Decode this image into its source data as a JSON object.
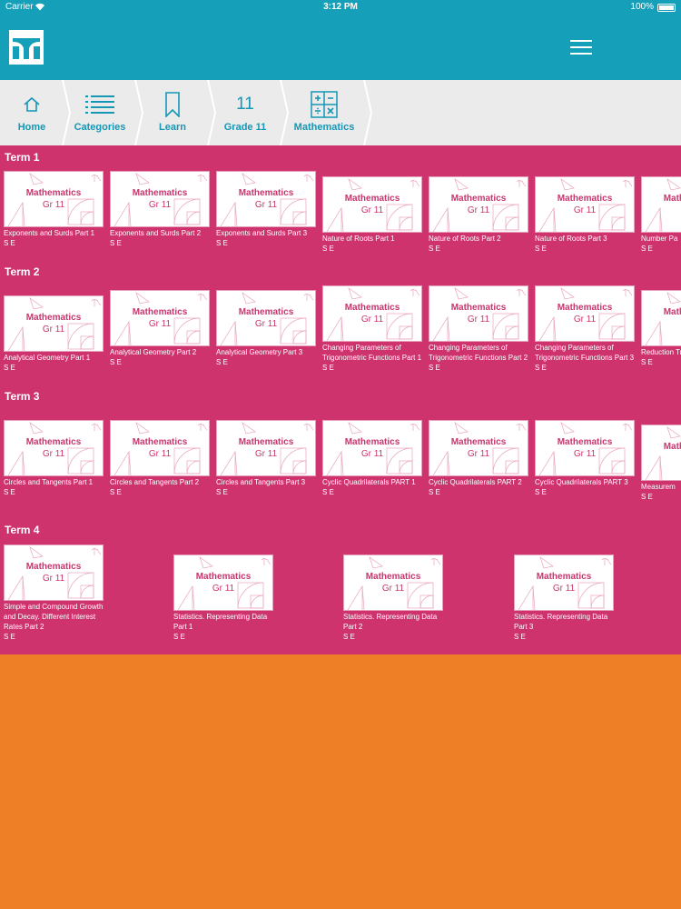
{
  "status_bar": {
    "carrier": "Carrier",
    "time": "3:12 PM",
    "battery": "100%"
  },
  "breadcrumbs": [
    {
      "label": "Home",
      "icon": "home-icon"
    },
    {
      "label": "Categories",
      "icon": "list-icon"
    },
    {
      "label": "Learn",
      "icon": "bookmark-icon"
    },
    {
      "label": "Grade 11",
      "icon_text": "11"
    },
    {
      "label": "Mathematics",
      "icon": "calculator-icon"
    }
  ],
  "colors": {
    "header": "#159fb8",
    "content": "#ce336d",
    "footer": "#ee7f27"
  },
  "terms": [
    {
      "title": "Term 1",
      "tiles": [
        {
          "subject": "Mathematics",
          "grade": "Gr 11",
          "title": "Exponents and Surds Part 1",
          "meta": "S E"
        },
        {
          "subject": "Mathematics",
          "grade": "Gr 11",
          "title": "Exponents and Surds Part 2",
          "meta": "S E"
        },
        {
          "subject": "Mathematics",
          "grade": "Gr 11",
          "title": "Exponents and Surds Part 3",
          "meta": "S E"
        },
        {
          "subject": "Mathematics",
          "grade": "Gr 11",
          "title": "Nature of Roots Part 1",
          "meta": "S E"
        },
        {
          "subject": "Mathematics",
          "grade": "Gr 11",
          "title": "Nature of Roots Part 2",
          "meta": "S E"
        },
        {
          "subject": "Mathematics",
          "grade": "Gr 11",
          "title": "Nature of Roots Part 3",
          "meta": "S E"
        },
        {
          "subject": "Mathematics",
          "grade": "",
          "title": "Number Pa",
          "meta": "S E"
        }
      ]
    },
    {
      "title": "Term 2",
      "tiles": [
        {
          "subject": "Mathematics",
          "grade": "Gr 11",
          "title": "Analytical Geometry Part 1",
          "meta": "S E"
        },
        {
          "subject": "Mathematics",
          "grade": "Gr 11",
          "title": "Analytical Geometry Part 2",
          "meta": "S E"
        },
        {
          "subject": "Mathematics",
          "grade": "Gr 11",
          "title": "Analytical Geometry Part 3",
          "meta": "S E"
        },
        {
          "subject": "Mathematics",
          "grade": "Gr 11",
          "title": "Changing Parameters of Trigonometric Functions Part 1",
          "meta": "S E"
        },
        {
          "subject": "Mathematics",
          "grade": "Gr 11",
          "title": "Changing Parameters of Trigonometric Functions Part 2",
          "meta": "S E"
        },
        {
          "subject": "Mathematics",
          "grade": "Gr 11",
          "title": "Changing Parameters of Trigonometric Functions Part 3",
          "meta": "S E"
        },
        {
          "subject": "Mathematics",
          "grade": "",
          "title": "Reduction Trig Ratios",
          "meta": "S E"
        }
      ]
    },
    {
      "title": "Term 3",
      "tiles": [
        {
          "subject": "Mathematics",
          "grade": "Gr 11",
          "title": "Circles and Tangents Part 1",
          "meta": "S E"
        },
        {
          "subject": "Mathematics",
          "grade": "Gr 11",
          "title": "Circles and Tangents Part 2",
          "meta": "S E"
        },
        {
          "subject": "Mathematics",
          "grade": "Gr 11",
          "title": "Circles and Tangents Part 3",
          "meta": "S E"
        },
        {
          "subject": "Mathematics",
          "grade": "Gr 11",
          "title": "Cyclic Quadrilaterals PART 1",
          "meta": "S E"
        },
        {
          "subject": "Mathematics",
          "grade": "Gr 11",
          "title": "Cyclic Quadrilaterals PART 2",
          "meta": "S E"
        },
        {
          "subject": "Mathematics",
          "grade": "Gr 11",
          "title": "Cyclic Quadrilaterals PART 3",
          "meta": "S E"
        },
        {
          "subject": "Mathematics",
          "grade": "",
          "title": "Measurem",
          "meta": "S E"
        }
      ]
    },
    {
      "title": "Term 4",
      "tiles": [
        {
          "subject": "Mathematics",
          "grade": "Gr 11",
          "title": "Simple and Compound Growth and Decay. Different Interest Rates Part 2",
          "meta": "S E"
        },
        {
          "subject": "Mathematics",
          "grade": "Gr 11",
          "title": "Statistics. Representing Data Part 1",
          "meta": "S E"
        },
        {
          "subject": "Mathematics",
          "grade": "Gr 11",
          "title": "Statistics. Representing Data Part 2",
          "meta": "S E"
        },
        {
          "subject": "Mathematics",
          "grade": "Gr 11",
          "title": "Statistics. Representing Data Part 3",
          "meta": "S E"
        }
      ]
    }
  ]
}
